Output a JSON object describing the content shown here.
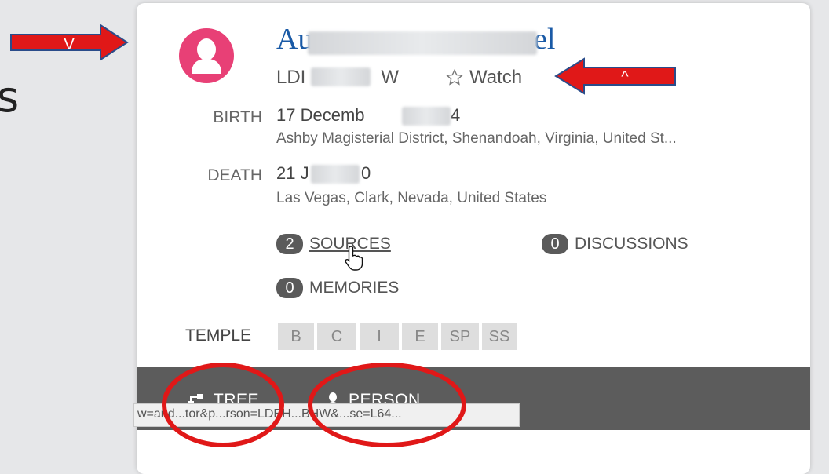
{
  "background": {
    "slide_letter": "s"
  },
  "person": {
    "name_visible_start": "Au",
    "name_visible_end": "el",
    "pid_start": "LDI",
    "pid_end": "W",
    "watch_label": "Watch"
  },
  "birth": {
    "label": "BIRTH",
    "date_visible_start": "17 Decemb",
    "date_visible_end": "4",
    "place": "Ashby Magisterial District, Shenandoah, Virginia, United St..."
  },
  "death": {
    "label": "DEATH",
    "date_visible_start": "21 J",
    "date_visible_end": "0",
    "place": "Las Vegas, Clark, Nevada, United States"
  },
  "stats": {
    "sources": {
      "count": "2",
      "label": "SOURCES"
    },
    "discussions": {
      "count": "0",
      "label": "DISCUSSIONS"
    },
    "memories": {
      "count": "0",
      "label": "MEMORIES"
    }
  },
  "temple": {
    "label": "TEMPLE",
    "ordinances": [
      "B",
      "C",
      "I",
      "E",
      "SP",
      "SS"
    ]
  },
  "footer": {
    "tree_label": "TREE",
    "person_label": "PERSON"
  },
  "status_bar": {
    "url": "w=and...tor&p...rson=LDBH...BHW&...se=L64..."
  },
  "annotations": {
    "left_arrow_label": "V",
    "right_arrow_label": "^",
    "color": "#e01818"
  },
  "colors": {
    "avatar": "#e84076",
    "name_link": "#1a5aa6",
    "bottom_bar": "#5c5c5c"
  }
}
